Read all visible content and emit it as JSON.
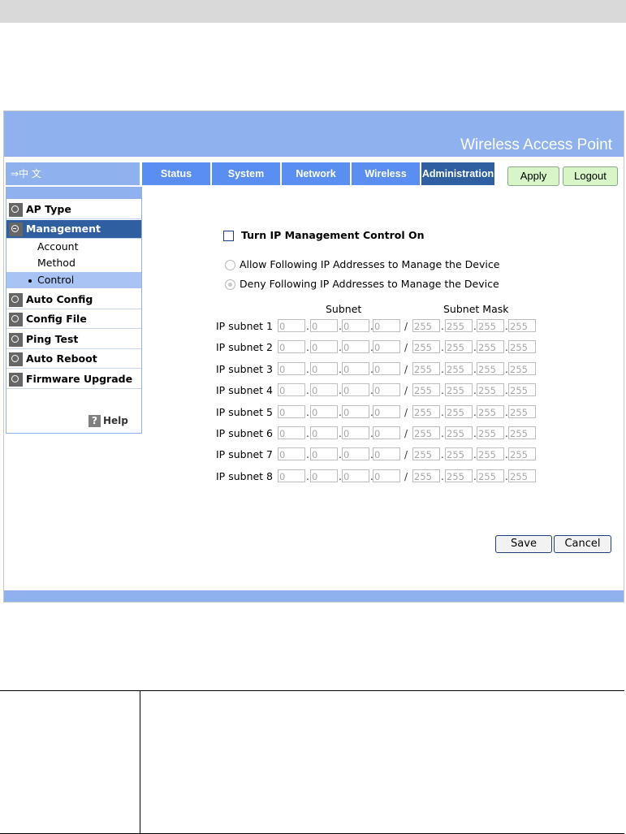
{
  "header": {
    "product_name": "Wireless Access Point",
    "language_link": "⇒中 文"
  },
  "tabs": [
    "Status",
    "System",
    "Network",
    "Wireless",
    "Administration"
  ],
  "active_tab": "Administration",
  "top_buttons": {
    "apply": "Apply",
    "logout": "Logout"
  },
  "sidebar": {
    "items": [
      {
        "label": "AP Type",
        "icon": "circle-icon"
      },
      {
        "label": "Management",
        "icon": "minus-circle-icon"
      },
      {
        "label": "Auto Config",
        "icon": "circle-icon"
      },
      {
        "label": "Config File",
        "icon": "circle-icon"
      },
      {
        "label": "Ping Test",
        "icon": "circle-icon"
      },
      {
        "label": "Auto Reboot",
        "icon": "circle-icon"
      },
      {
        "label": "Firmware Upgrade",
        "icon": "circle-icon"
      }
    ],
    "subitems": [
      "Account",
      "Method",
      "Control"
    ],
    "help": "Help",
    "help_icon": "?"
  },
  "form": {
    "checkbox_label": "Turn IP Management Control On",
    "radio_allow": "Allow Following IP Addresses to Manage the Device",
    "radio_deny": "Deny Following IP Addresses to Manage the Device",
    "subnet_header": "Subnet",
    "mask_header": "Subnet Mask",
    "slash": "/",
    "dot": ".",
    "rows": [
      {
        "label": "IP subnet 1",
        "ip": [
          "0",
          "0",
          "0",
          "0"
        ],
        "mask": [
          "255",
          "255",
          "255",
          "255"
        ]
      },
      {
        "label": "IP subnet 2",
        "ip": [
          "0",
          "0",
          "0",
          "0"
        ],
        "mask": [
          "255",
          "255",
          "255",
          "255"
        ]
      },
      {
        "label": "IP subnet 3",
        "ip": [
          "0",
          "0",
          "0",
          "0"
        ],
        "mask": [
          "255",
          "255",
          "255",
          "255"
        ]
      },
      {
        "label": "IP subnet 4",
        "ip": [
          "0",
          "0",
          "0",
          "0"
        ],
        "mask": [
          "255",
          "255",
          "255",
          "255"
        ]
      },
      {
        "label": "IP subnet 5",
        "ip": [
          "0",
          "0",
          "0",
          "0"
        ],
        "mask": [
          "255",
          "255",
          "255",
          "255"
        ]
      },
      {
        "label": "IP subnet 6",
        "ip": [
          "0",
          "0",
          "0",
          "0"
        ],
        "mask": [
          "255",
          "255",
          "255",
          "255"
        ]
      },
      {
        "label": "IP subnet 7",
        "ip": [
          "0",
          "0",
          "0",
          "0"
        ],
        "mask": [
          "255",
          "255",
          "255",
          "255"
        ]
      },
      {
        "label": "IP subnet 8",
        "ip": [
          "0",
          "0",
          "0",
          "0"
        ],
        "mask": [
          "255",
          "255",
          "255",
          "255"
        ]
      }
    ],
    "save": "Save",
    "cancel": "Cancel"
  },
  "colors": {
    "header_blue": "#8fb1ee",
    "tab_blue": "#5a8ef0",
    "active_blue": "#2f5fa0"
  }
}
